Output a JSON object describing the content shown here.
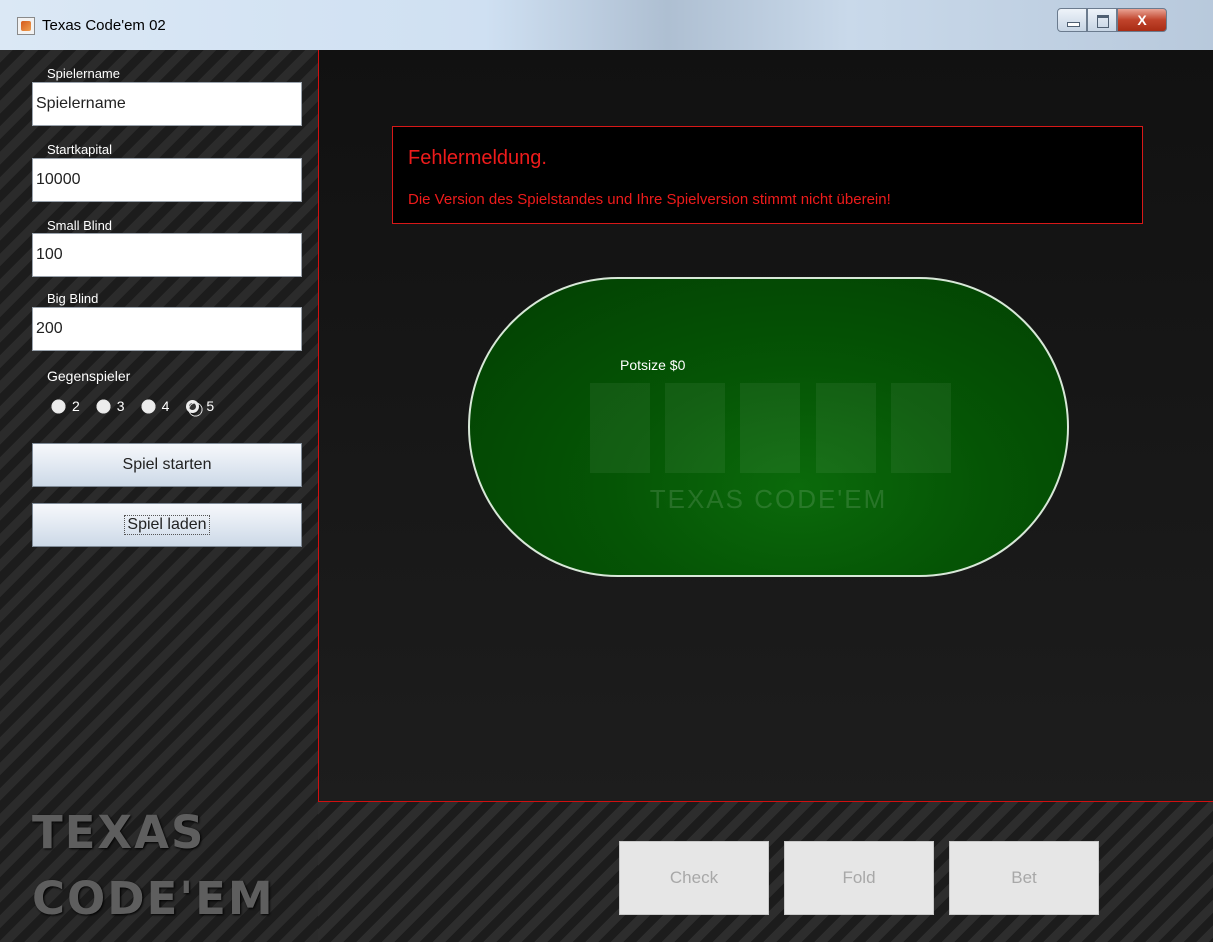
{
  "window": {
    "title": "Texas Code'em 02",
    "close_glyph": "X"
  },
  "sidebar": {
    "player_name": {
      "label": "Spielername",
      "value": "Spielername"
    },
    "start_capital": {
      "label": "Startkapital",
      "value": "10000"
    },
    "small_blind": {
      "label": "Small Blind",
      "value": "100"
    },
    "big_blind": {
      "label": "Big Blind",
      "value": "200"
    },
    "opponents": {
      "label": "Gegenspieler",
      "options": [
        "2",
        "3",
        "4",
        "5"
      ],
      "selected": "5"
    },
    "start_button": "Spiel starten",
    "load_button": "Spiel laden",
    "logo_line1": "TEXAS",
    "logo_line2": "CODE'EM"
  },
  "error": {
    "title": "Fehlermeldung.",
    "message": "Die Version des Spielstandes und Ihre Spielversion stimmt nicht überein!"
  },
  "table": {
    "potsize": "Potsize $0",
    "logo": "TEXAS CODE'EM"
  },
  "actions": {
    "check": "Check",
    "fold": "Fold",
    "bet": "Bet"
  },
  "colors": {
    "error_red": "#ee1b1b",
    "felt_green": "#055505",
    "panel_border": "#d01010"
  }
}
